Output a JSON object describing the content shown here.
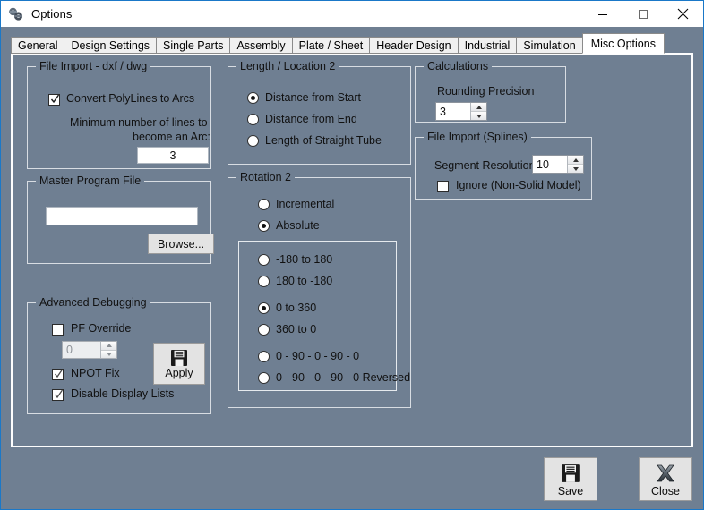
{
  "window": {
    "title": "Options",
    "icon": "app-gears-icon",
    "controls": {
      "minimize": "minimize-icon",
      "maximize": "maximize-icon",
      "close": "close-icon"
    },
    "accent_border": "#1a78c8",
    "client_background": "#6f7f92"
  },
  "tabs": [
    {
      "label": "General",
      "active": false
    },
    {
      "label": "Design Settings",
      "active": false
    },
    {
      "label": "Single Parts",
      "active": false
    },
    {
      "label": "Assembly",
      "active": false
    },
    {
      "label": "Plate / Sheet",
      "active": false
    },
    {
      "label": "Header Design",
      "active": false
    },
    {
      "label": "Industrial",
      "active": false
    },
    {
      "label": "Simulation",
      "active": false
    },
    {
      "label": "Misc Options",
      "active": true
    }
  ],
  "file_import_dxf": {
    "title": "File Import - dxf / dwg",
    "convert_polylines": {
      "label": "Convert PolyLines to Arcs",
      "checked": true
    },
    "min_lines_label_line1": "Minimum number of lines to",
    "min_lines_label_line2": "become an Arc:",
    "min_lines_value": "3"
  },
  "master_program_file": {
    "title": "Master Program File",
    "path_value": "",
    "path_placeholder": "",
    "browse_label": "Browse..."
  },
  "advanced_debugging": {
    "title": "Advanced Debugging",
    "pf_override": {
      "label": "PF Override",
      "checked": false
    },
    "pf_value": "0",
    "pf_enabled": false,
    "npot_fix": {
      "label": "NPOT Fix",
      "checked": true
    },
    "disable_display_lists": {
      "label": "Disable Display Lists",
      "checked": true
    },
    "apply_label": "Apply",
    "apply_icon": "save-disk-icon"
  },
  "length_location": {
    "title": "Length / Location 2",
    "options": [
      {
        "label": "Distance from Start",
        "selected": true
      },
      {
        "label": "Distance from End",
        "selected": false
      },
      {
        "label": "Length of Straight Tube",
        "selected": false
      }
    ]
  },
  "rotation": {
    "title": "Rotation 2",
    "mode_options": [
      {
        "label": "Incremental",
        "selected": false
      },
      {
        "label": "Absolute",
        "selected": true
      }
    ],
    "range_options": [
      {
        "label": "-180 to  180",
        "selected": false
      },
      {
        "label": "180 to  -180",
        "selected": false
      },
      {
        "label": "0 to  360",
        "selected": true
      },
      {
        "label": "360 to  0",
        "selected": false
      },
      {
        "label": "0 - 90 - 0 - 90 - 0",
        "selected": false
      },
      {
        "label": "0 - 90 - 0 - 90 - 0   Reversed",
        "selected": false
      }
    ]
  },
  "calculations": {
    "title": "Calculations",
    "rounding_precision_label": "Rounding Precision",
    "rounding_precision_value": "3"
  },
  "file_import_splines": {
    "title": "File Import (Splines)",
    "segment_resolution_label": "Segment Resolution:",
    "segment_resolution_value": "10",
    "ignore_non_solid": {
      "label": "Ignore (Non-Solid Model)",
      "checked": false
    }
  },
  "footer": {
    "save_label": "Save",
    "save_icon": "save-disk-icon",
    "close_label": "Close",
    "close_icon": "close-cross-icon"
  }
}
